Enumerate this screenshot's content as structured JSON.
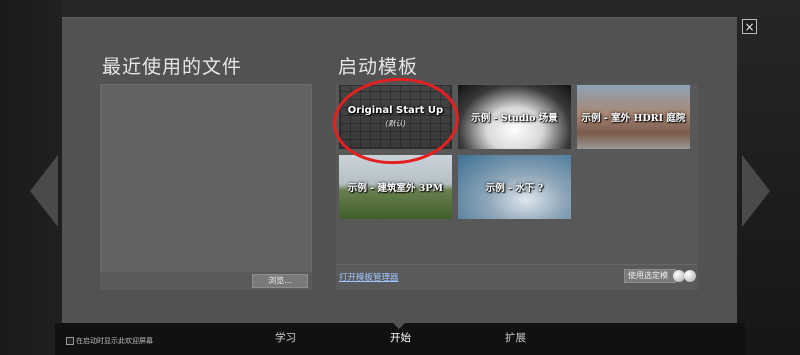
{
  "dialog": {
    "close_glyph": "×",
    "left_arrow_icon": "chevron-left-icon",
    "right_arrow_icon": "chevron-right-icon"
  },
  "recent": {
    "title": "最近使用的文件",
    "browse_label": "浏览..."
  },
  "templates": {
    "title": "启动模板",
    "items": [
      {
        "label": "Original Start Up",
        "sub": "(默认)"
      },
      {
        "label": "示例 - Studio 场景"
      },
      {
        "label": "示例 - 室外 HDRI 庭院"
      },
      {
        "label": "示例 - 建筑室外 3PM"
      },
      {
        "label": "示例 - 水下 ?"
      }
    ],
    "manager_link": "打开模板管理器",
    "use_selected_label": "使用选定模"
  },
  "footer": {
    "startup_checkbox_label": "在启动时显示此欢迎屏幕",
    "tabs": [
      {
        "label": "学习"
      },
      {
        "label": "开始"
      },
      {
        "label": "扩展"
      }
    ]
  },
  "colors": {
    "dialog_bg": "#525252",
    "annotation_circle": "#e52020",
    "link": "#9ec6ff"
  }
}
